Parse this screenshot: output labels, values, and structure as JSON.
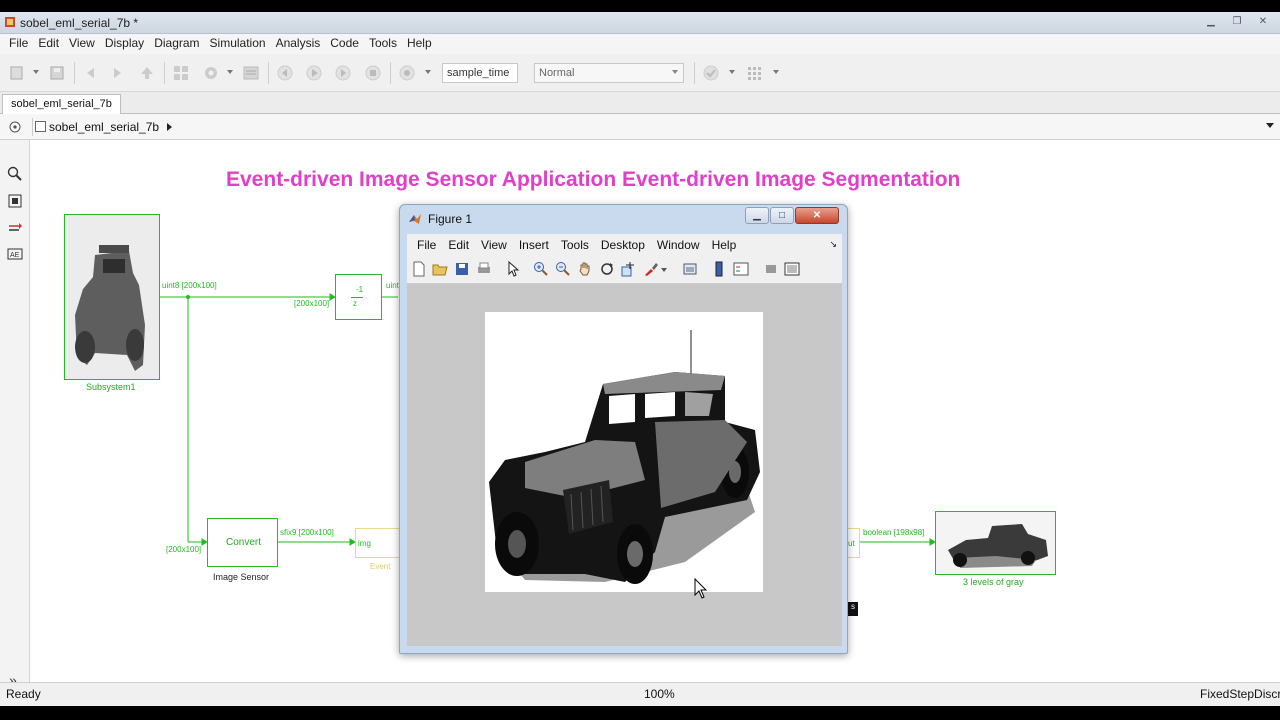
{
  "window": {
    "title": "sobel_eml_serial_7b *"
  },
  "menu": [
    "File",
    "Edit",
    "View",
    "Display",
    "Diagram",
    "Simulation",
    "Analysis",
    "Code",
    "Tools",
    "Help"
  ],
  "toolbar": {
    "stop_time": "sample_time",
    "sim_mode": "Normal"
  },
  "tab": {
    "label": "sobel_eml_serial_7b"
  },
  "breadcrumb": {
    "label": "sobel_eml_serial_7b"
  },
  "diagram": {
    "title": "Event-driven Image Sensor Application Event-driven Image Segmentation",
    "blocks": {
      "subsystem1": "Subsystem1",
      "delay_num": "-1",
      "delay_den": "z",
      "convert": "Convert",
      "image_sensor": "Image Sensor",
      "img_port": "img",
      "event_label": "Event",
      "out_port": "ut",
      "gray": "3 levels of gray",
      "ms": "s"
    },
    "signals": {
      "s1": "uint8 [200x100]",
      "s2": "[200x100]",
      "s3": "uint",
      "s4": "[200x100]",
      "s5": "sfix9 [200x100]",
      "s6": "boolean [198x98]"
    }
  },
  "status": {
    "ready": "Ready",
    "zoom": "100%",
    "solver": "FixedStepDiscrete"
  },
  "figure": {
    "title": "Figure 1",
    "menu": [
      "File",
      "Edit",
      "View",
      "Insert",
      "Tools",
      "Desktop",
      "Window",
      "Help"
    ]
  },
  "colors": {
    "signal": "#22bb22",
    "title": "#e040c8"
  }
}
